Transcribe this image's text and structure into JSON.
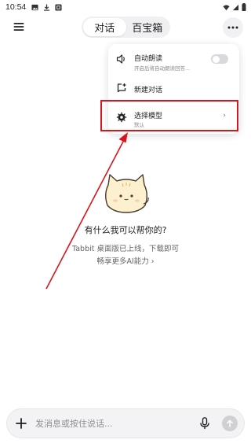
{
  "status_bar": {
    "time": "10:54",
    "left_icons": [
      "image-icon",
      "download-icon",
      "app-icon"
    ],
    "right_icons": [
      "wifi-icon",
      "signal-icon",
      "battery-icon"
    ]
  },
  "header": {
    "menu_icon": "hamburger-menu-icon",
    "tabs": [
      {
        "label": "对话",
        "active": true
      },
      {
        "label": "百宝箱",
        "active": false
      }
    ],
    "more_icon": "more-dots-icon"
  },
  "dropdown": {
    "items": [
      {
        "title": "自动朗读",
        "subtitle": "开启后将自动朗读回答...",
        "icon": "speaker-icon",
        "toggle": false
      },
      {
        "title": "新建对话",
        "subtitle": "",
        "icon": "new-chat-icon"
      },
      {
        "title": "选择模型",
        "subtitle": "默认",
        "icon": "model-chip-icon",
        "chevron": "›"
      }
    ]
  },
  "annotation": {
    "color": "#d9151c"
  },
  "welcome": {
    "mascot": "cat-mascot",
    "title": "有什么我可以帮你的?",
    "line1": "Tabbit 桌面版已上线，下载即可",
    "line2": "畅享更多AI能力 ›"
  },
  "composer": {
    "placeholder": "发消息或按住说话...",
    "value": "",
    "plus_icon": "plus-icon",
    "mic_icon": "mic-icon",
    "send_icon": "arrow-up-icon"
  }
}
